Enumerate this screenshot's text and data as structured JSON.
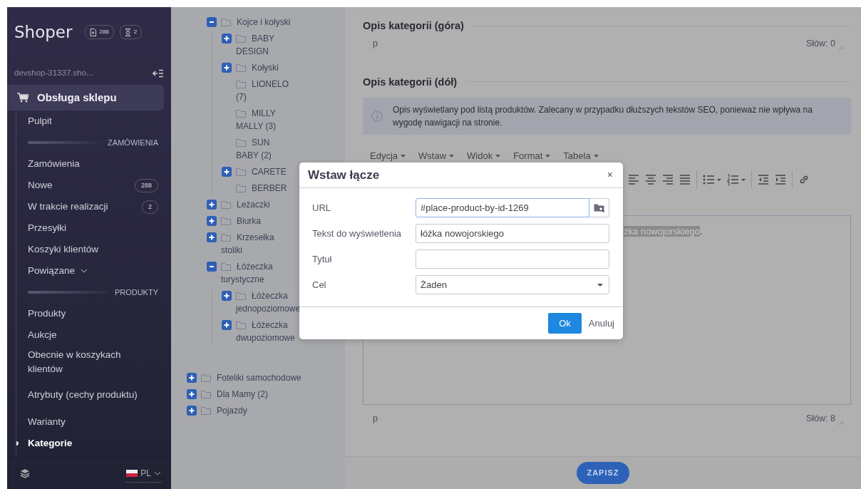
{
  "sidebar": {
    "logo": "Shoper",
    "counters": [
      {
        "kind": "document",
        "count": "288"
      },
      {
        "kind": "hourglass",
        "count": "2"
      }
    ],
    "shop": "devshop-31337.sho...",
    "section": {
      "label": "Obsługa sklepu",
      "selected": true
    },
    "items": [
      {
        "kind": "link",
        "label": "Pulpit",
        "selected": false
      },
      {
        "kind": "header",
        "label": "ZAMÓWIENIA"
      },
      {
        "kind": "link",
        "label": "Zamówienia",
        "selected": false
      },
      {
        "kind": "link",
        "label": "Nowe",
        "badge": "288",
        "selected": false
      },
      {
        "kind": "link",
        "label": "W trakcie realizacji",
        "badge": "2",
        "selected": false
      },
      {
        "kind": "link",
        "label": "Przesyłki",
        "selected": false
      },
      {
        "kind": "link",
        "label": "Koszyki klientów",
        "selected": false
      },
      {
        "kind": "dropdown",
        "label": "Powiązane",
        "expanded": false,
        "selected": false
      },
      {
        "kind": "header",
        "label": "PRODUKTY"
      },
      {
        "kind": "link",
        "label": "Produkty",
        "selected": false
      },
      {
        "kind": "link",
        "label": "Aukcje",
        "selected": false
      },
      {
        "kind": "link",
        "label": "Obecnie w koszykach klientów",
        "selected": false
      },
      {
        "kind": "link",
        "label": "Atrybuty (cechy produktu)",
        "selected": false
      },
      {
        "kind": "link",
        "label": "Warianty",
        "selected": false
      },
      {
        "kind": "link",
        "label": "Kategorie",
        "selected": true
      }
    ],
    "language": "PL"
  },
  "tree": {
    "continued": [
      {
        "kind": "branch",
        "label": "Kojce i kołyski",
        "expanded": true,
        "children": [
          {
            "kind": "branch",
            "label": "BABY DESIGN",
            "expanded": false
          },
          {
            "kind": "branch",
            "label": "Kołyski",
            "expanded": false
          },
          {
            "kind": "leaf",
            "label": "LIONELO (7)"
          },
          {
            "kind": "leaf",
            "label": "MILLY MALLY (3)"
          },
          {
            "kind": "leaf",
            "label": "SUN BABY (2)"
          },
          {
            "kind": "branch",
            "label": "CARETE",
            "expanded": false
          },
          {
            "kind": "leaf",
            "label": "BERBER"
          }
        ]
      },
      {
        "kind": "branch",
        "label": "Leżaczki",
        "expanded": false
      },
      {
        "kind": "branch",
        "label": "Biurka",
        "expanded": false
      },
      {
        "kind": "branch",
        "label": "Krzesełka stoliki",
        "expanded": false
      },
      {
        "kind": "branch",
        "label": "Łóżeczka turystyczne",
        "expanded": true,
        "children": [
          {
            "kind": "branch",
            "label": "Łóżeczka jednopoziomowe",
            "expanded": false
          },
          {
            "kind": "branch",
            "label": "Łóżeczka dwupoziomowe",
            "expanded": false
          }
        ]
      }
    ],
    "items": [
      {
        "kind": "branch",
        "label": "Foteliki samochodowe",
        "expanded": false
      },
      {
        "kind": "branch",
        "label": "Dla Mamy (2)",
        "expanded": false
      },
      {
        "kind": "branch",
        "label": "Pojazdy",
        "expanded": false
      }
    ]
  },
  "top_description": {
    "title": "Opis kategorii (góra)",
    "path": "p",
    "word_count": "Słów: 0"
  },
  "bottom_description": {
    "title": "Opis kategorii (dół)",
    "info": "Opis wyświetlany pod listą produktów. Zalecany w przypadku dłuższych tekstów SEO, ponieważ nie wpływa na wygodę nawigacji na stronie.",
    "menu": [
      "Edycja",
      "Wstaw",
      "Widok",
      "Format",
      "Tabela"
    ],
    "toolbar": [
      {
        "kind": "align-left"
      },
      {
        "kind": "align-center"
      },
      {
        "kind": "align-right"
      },
      {
        "kind": "justify"
      },
      {
        "kind": "separator"
      },
      {
        "kind": "bullet-list"
      },
      {
        "kind": "numbered-list"
      },
      {
        "kind": "separator"
      },
      {
        "kind": "outdent"
      },
      {
        "kind": "indent"
      },
      {
        "kind": "separator"
      },
      {
        "kind": "link"
      }
    ],
    "selected_text": "żka nowojorskiego",
    "text_tail": ".",
    "path": "p",
    "word_count": "Słów: 8"
  },
  "save_button": "ZAPISZ",
  "dialog": {
    "title": "Wstaw łącze",
    "close": "×",
    "fields": [
      {
        "kind": "url",
        "label": "URL",
        "value": "#place-product-by-id-1269"
      },
      {
        "kind": "text",
        "label": "Tekst do wyświetlenia",
        "value": "łóżka nowojorskiego"
      },
      {
        "kind": "text",
        "label": "Tytuł"
      },
      {
        "kind": "select",
        "label": "Cel",
        "value": "Żaden"
      }
    ],
    "buttons": [
      {
        "kind": "primary",
        "label": "Ok"
      },
      {
        "kind": "link",
        "label": "Anuluj"
      }
    ]
  }
}
